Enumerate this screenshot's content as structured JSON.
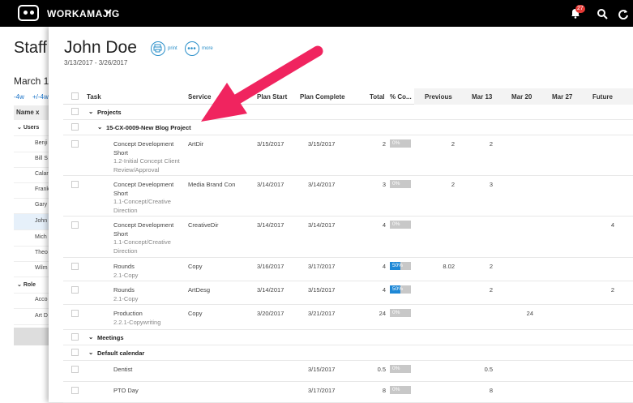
{
  "topbar": {
    "brand": "WORKAMAJIG",
    "notifications_count": "27"
  },
  "background_page": {
    "title": "Staff",
    "date": "March 1",
    "links": [
      "-4w",
      "+/-4w"
    ],
    "header": "Name x",
    "groups": [
      {
        "label": "Users",
        "items": [
          "Benji",
          "Bill S",
          "Calar",
          "Frank",
          "Gary",
          "John",
          "Mich",
          "Theo",
          "Wilm"
        ]
      },
      {
        "label": "Role",
        "items": [
          "Acco",
          "Art D"
        ]
      }
    ]
  },
  "panel": {
    "title": "John Doe",
    "dates": "3/13/2017 - 3/26/2017",
    "print_label": "print",
    "more_label": "more",
    "columns": [
      "Task",
      "Service",
      "Plan Start",
      "Plan Complete",
      "Total",
      "% Co...",
      "Previous",
      "Mar 13",
      "Mar 20",
      "Mar 27",
      "Future"
    ],
    "groups": {
      "projects": "Projects",
      "project_name": "15-CX-0009-New Blog Project",
      "meetings": "Meetings",
      "calendar": "Default calendar"
    },
    "rows": [
      {
        "task": "Concept Development Short",
        "sub": "1.2-Initial Concept Client Review/Approval",
        "service": "ArtDir",
        "start": "3/15/2017",
        "complete": "3/15/2017",
        "total": "2",
        "pct": "0%",
        "pct_value": 0,
        "previous": "2",
        "mar13": "2",
        "mar20": "",
        "mar27": "",
        "future": ""
      },
      {
        "task": "Concept Development Short",
        "sub": "1.1-Concept/Creative Direction",
        "service": "Media Brand Con",
        "start": "3/14/2017",
        "complete": "3/14/2017",
        "total": "3",
        "pct": "0%",
        "pct_value": 0,
        "previous": "2",
        "mar13": "3",
        "mar20": "",
        "mar27": "",
        "future": ""
      },
      {
        "task": "Concept Development Short",
        "sub": "1.1-Concept/Creative Direction",
        "service": "CreativeDir",
        "start": "3/14/2017",
        "complete": "3/14/2017",
        "total": "4",
        "pct": "0%",
        "pct_value": 0,
        "previous": "",
        "mar13": "",
        "mar20": "",
        "mar27": "",
        "future": "4"
      },
      {
        "task": "Rounds",
        "sub": "2.1-Copy",
        "service": "Copy",
        "start": "3/16/2017",
        "complete": "3/17/2017",
        "total": "4",
        "pct": "50%",
        "pct_value": 50,
        "previous": "8.02",
        "mar13": "2",
        "mar20": "",
        "mar27": "",
        "future": ""
      },
      {
        "task": "Rounds",
        "sub": "2.1-Copy",
        "service": "ArtDesg",
        "start": "3/14/2017",
        "complete": "3/15/2017",
        "total": "4",
        "pct": "50%",
        "pct_value": 50,
        "previous": "",
        "mar13": "2",
        "mar20": "",
        "mar27": "",
        "future": "2"
      },
      {
        "task": "Production",
        "sub": "2.2.1-Copywriting",
        "service": "Copy",
        "start": "3/20/2017",
        "complete": "3/21/2017",
        "total": "24",
        "pct": "0%",
        "pct_value": 0,
        "previous": "",
        "mar13": "",
        "mar20": "24",
        "mar27": "",
        "future": ""
      }
    ],
    "meeting_rows": [
      {
        "task": "Dentist",
        "service": "",
        "start": "",
        "complete": "3/15/2017",
        "total": "0.5",
        "pct": "0%",
        "pct_value": 0,
        "previous": "",
        "mar13": "0.5",
        "mar20": "",
        "mar27": "",
        "future": ""
      },
      {
        "task": "PTO Day",
        "service": "",
        "start": "",
        "complete": "3/17/2017",
        "total": "8",
        "pct": "0%",
        "pct_value": 0,
        "previous": "",
        "mar13": "8",
        "mar20": "",
        "mar27": "",
        "future": ""
      }
    ]
  },
  "colors": {
    "accent": "#2a8fc9",
    "arrow": "#f0245f",
    "topbar": "#000000",
    "progress": "#1e88d6"
  }
}
